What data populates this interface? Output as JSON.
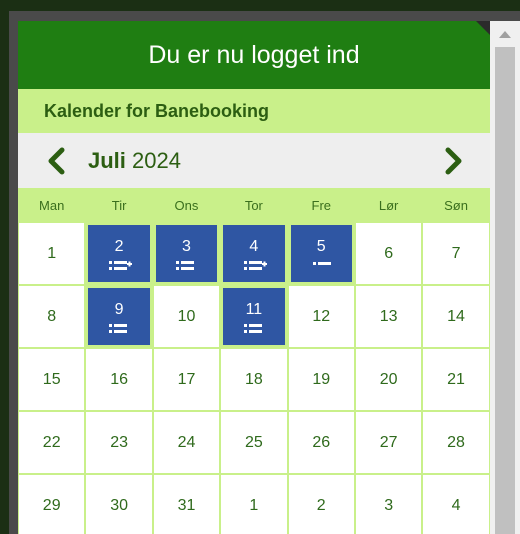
{
  "banner": {
    "text": "Du er nu logget ind"
  },
  "subtitle": "Kalender for Banebooking",
  "nav": {
    "month": "Juli",
    "year": "2024"
  },
  "weekdays": [
    "Man",
    "Tir",
    "Ons",
    "Tor",
    "Fre",
    "Lør",
    "Søn"
  ],
  "days": [
    {
      "label": "1",
      "booked": false
    },
    {
      "label": "2",
      "booked": true,
      "icon": "list-plus-icon"
    },
    {
      "label": "3",
      "booked": true,
      "icon": "list-icon"
    },
    {
      "label": "4",
      "booked": true,
      "icon": "list-plus-icon"
    },
    {
      "label": "5",
      "booked": true,
      "icon": "single-line-icon"
    },
    {
      "label": "6",
      "booked": false
    },
    {
      "label": "7",
      "booked": false
    },
    {
      "label": "8",
      "booked": false
    },
    {
      "label": "9",
      "booked": true,
      "icon": "list-icon"
    },
    {
      "label": "10",
      "booked": false
    },
    {
      "label": "11",
      "booked": true,
      "icon": "list-icon"
    },
    {
      "label": "12",
      "booked": false
    },
    {
      "label": "13",
      "booked": false
    },
    {
      "label": "14",
      "booked": false
    },
    {
      "label": "15",
      "booked": false
    },
    {
      "label": "16",
      "booked": false
    },
    {
      "label": "17",
      "booked": false
    },
    {
      "label": "18",
      "booked": false
    },
    {
      "label": "19",
      "booked": false
    },
    {
      "label": "20",
      "booked": false
    },
    {
      "label": "21",
      "booked": false
    },
    {
      "label": "22",
      "booked": false
    },
    {
      "label": "23",
      "booked": false
    },
    {
      "label": "24",
      "booked": false
    },
    {
      "label": "25",
      "booked": false
    },
    {
      "label": "26",
      "booked": false
    },
    {
      "label": "27",
      "booked": false
    },
    {
      "label": "28",
      "booked": false
    },
    {
      "label": "29",
      "booked": false
    },
    {
      "label": "30",
      "booked": false
    },
    {
      "label": "31",
      "booked": false
    },
    {
      "label": "1",
      "booked": false
    },
    {
      "label": "2",
      "booked": false
    },
    {
      "label": "3",
      "booked": false
    },
    {
      "label": "4",
      "booked": false
    }
  ],
  "colors": {
    "banner": "#1f7e12",
    "accent": "#c9f08a",
    "booked": "#2f56a3",
    "text": "#2f6a1c"
  }
}
